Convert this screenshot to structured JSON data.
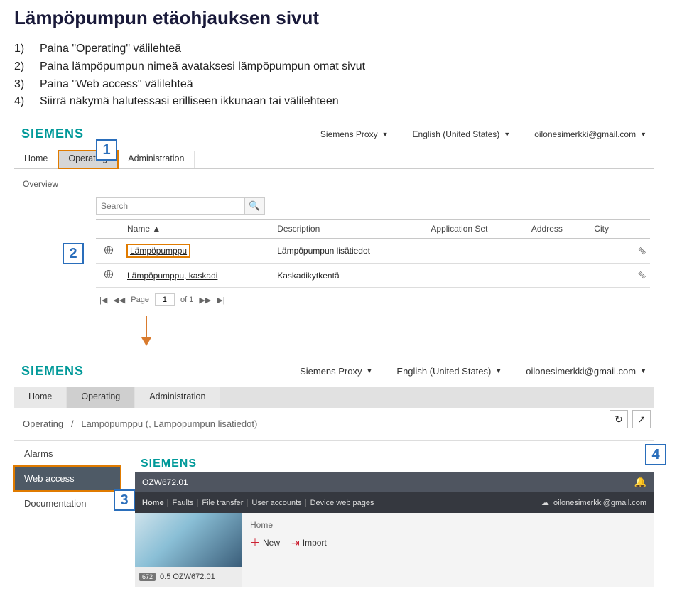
{
  "doc": {
    "title": "Lämpöpumpun etäohjauksen sivut",
    "steps": [
      "Paina \"Operating\" välilehteä",
      "Paina lämpöpumpun nimeä avataksesi lämpöpumpun omat sivut",
      "Paina \"Web access\" välilehteä",
      "Siirrä näkymä halutessasi erilliseen ikkunaan tai välilehteen"
    ]
  },
  "badges": {
    "b1": "1",
    "b2": "2",
    "b3": "3",
    "b4": "4"
  },
  "screenshot1": {
    "logo": "SIEMENS",
    "topdrops": [
      "Siemens Proxy",
      "English (United States)",
      "oilonesimerkki@gmail.com"
    ],
    "tabs": {
      "home": "Home",
      "operating": "Operating",
      "admin": "Administration"
    },
    "side_label": "Overview",
    "search_placeholder": "Search",
    "columns": {
      "name": "Name",
      "sort": "▲",
      "desc": "Description",
      "appset": "Application Set",
      "addr": "Address",
      "city": "City"
    },
    "rows": [
      {
        "name": "Lämpöpumppu",
        "desc": "Lämpöpumpun lisätiedot"
      },
      {
        "name": "Lämpöpumppu, kaskadi",
        "desc": "Kaskadikytkentä"
      }
    ],
    "pager": {
      "first": "|◀",
      "prev": "◀◀",
      "page_lbl": "Page",
      "page": "1",
      "of": "of 1",
      "next": "▶▶",
      "last": "▶|"
    }
  },
  "screenshot2": {
    "logo": "SIEMENS",
    "topdrops": [
      "Siemens Proxy",
      "English (United States)",
      "oilonesimerkki@gmail.com"
    ],
    "tabs": {
      "home": "Home",
      "operating": "Operating",
      "admin": "Administration"
    },
    "crumb": {
      "op": "Operating",
      "sep": "/",
      "item": "Lämpöpumppu (, Lämpöpumpun lisätiedot)"
    },
    "leftnav": {
      "alarms": "Alarms",
      "web": "Web access",
      "doc": "Documentation"
    },
    "util": {
      "refresh": "↻",
      "popout": "↗"
    },
    "inner": {
      "logo": "SIEMENS",
      "device": "OZW672.01",
      "bell": "🔔",
      "menu": [
        "Home",
        "Faults",
        "File transfer",
        "User accounts",
        "Device web pages"
      ],
      "user": "oilonesimerkki@gmail.com",
      "side_version": "0.5 OZW672.01",
      "side_chip": "672",
      "main_label": "Home",
      "btn_new": "New",
      "btn_import": "Import"
    }
  }
}
